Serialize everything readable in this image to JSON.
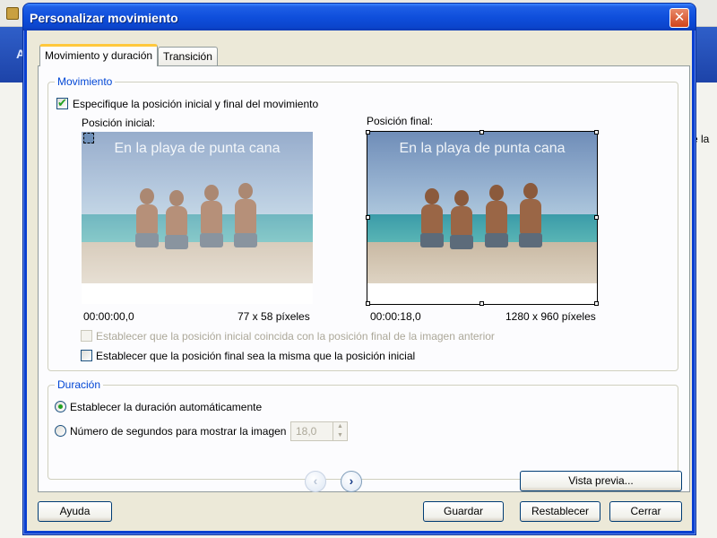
{
  "window": {
    "title": "Personalizar movimiento",
    "close_symbol": "✕"
  },
  "background": {
    "partial_text": "e la",
    "partial_letter": "A"
  },
  "tabs": [
    {
      "label": "Movimiento y duración",
      "active": true
    },
    {
      "label": "Transición",
      "active": false
    }
  ],
  "movimiento": {
    "legend": "Movimiento",
    "specify_checkbox": {
      "label": "Especifique la posición inicial y final del movimiento",
      "checked": true
    },
    "initial": {
      "label": "Posición inicial:",
      "caption": "En la playa de punta cana",
      "time": "00:00:00,0",
      "size": "77 x 58 píxeles"
    },
    "final": {
      "label": "Posición final:",
      "caption": "En la playa de punta cana",
      "time": "00:00:18,0",
      "size": "1280 x 960 píxeles"
    },
    "match_previous": {
      "label": "Establecer que la posición inicial coincida con la posición final de la imagen anterior",
      "checked": false,
      "disabled": true
    },
    "same_position": {
      "label": "Establecer que la posición final sea la misma que la posición inicial",
      "checked": false
    }
  },
  "duracion": {
    "legend": "Duración",
    "auto": {
      "label": "Establecer la duración automáticamente",
      "selected": true
    },
    "seconds": {
      "label": "Número de segundos para mostrar la imagen",
      "selected": false
    },
    "seconds_value": "18,0"
  },
  "nav": {
    "prev_symbol": "‹",
    "next_symbol": "›"
  },
  "buttons": {
    "preview": "Vista previa...",
    "help": "Ayuda",
    "save": "Guardar",
    "reset": "Restablecer",
    "close": "Cerrar"
  },
  "colors": {
    "title_bar": "#0a3fd0",
    "legend_text": "#0046d5",
    "dialog_bg": "#ece9d8",
    "close_button": "#d2431b"
  }
}
